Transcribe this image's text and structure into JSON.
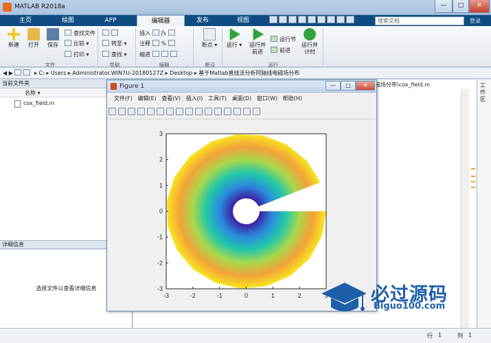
{
  "window": {
    "title": "MATLAB R2018a",
    "min": "—",
    "max": "□",
    "close": "✕"
  },
  "tabs": [
    {
      "label": "主页"
    },
    {
      "label": "绘图"
    },
    {
      "label": "APP"
    },
    {
      "label": "编辑器"
    },
    {
      "label": "发布"
    },
    {
      "label": "视图"
    }
  ],
  "search": {
    "placeholder": "搜索文档",
    "login": "登录"
  },
  "ribbon": {
    "new": "新建",
    "open": "打开",
    "save": "保存",
    "find_files": "查找文件",
    "compare": "比较",
    "print": "打印",
    "goto": "转至",
    "find": "查找",
    "insert": "插入",
    "comment": "注释",
    "indent": "缩进",
    "breakpoints": "断点",
    "run": "运行",
    "run_advance": "运行并\n前进",
    "run_section": "运行节",
    "advance": "前进",
    "run_time": "运行并\n计时",
    "groups": {
      "file": "文件",
      "navigate": "导航",
      "edit": "编辑",
      "breakpoints": "断点",
      "run": "运行"
    }
  },
  "path": {
    "segments": [
      "C:",
      "Users",
      "Administrator.WIN7U-20180127Z",
      "Desktop",
      "基于Matlab直线法分析同轴线电磁场分布"
    ]
  },
  "current_folder": {
    "title": "当前文件夹",
    "column_name": "名称",
    "files": [
      {
        "name": "cox_field.m"
      }
    ]
  },
  "details": {
    "title": "详细信息",
    "hint": "选择文件以查看详细信息"
  },
  "editor": {
    "path_tail": "线电磁场分布\\cox_field.m"
  },
  "workspace": {
    "label": "工作区"
  },
  "status": {
    "row_label": "行",
    "row": "1",
    "col_label": "列",
    "col": "1"
  },
  "figure": {
    "title": "Figure 1",
    "menus": [
      "文件(F)",
      "编辑(E)",
      "查看(V)",
      "插入(I)",
      "工具(T)",
      "桌面(D)",
      "窗口(W)",
      "帮助(H)"
    ]
  },
  "logo": {
    "main": "必过源码",
    "sub": "Biguo100.com"
  },
  "chart_data": {
    "type": "heatmap",
    "description_shape": "annulus",
    "x_ticks": [
      -3,
      -2,
      -1,
      0,
      1,
      2,
      3
    ],
    "y_ticks": [
      3,
      2,
      1,
      0,
      -1,
      -2,
      -3
    ],
    "xlim": [
      -3,
      3
    ],
    "ylim": [
      -3,
      3
    ],
    "inner_radius": 0.5,
    "outer_radius": 3,
    "gap_angle_deg": [
      0,
      22
    ],
    "colormap": [
      "#3b1fa0",
      "#2a8be0",
      "#23c7a8",
      "#a8d84b",
      "#f2a23a",
      "#f8e81e"
    ],
    "color_stops": [
      0,
      0.2,
      0.4,
      0.6,
      0.8,
      1
    ]
  }
}
